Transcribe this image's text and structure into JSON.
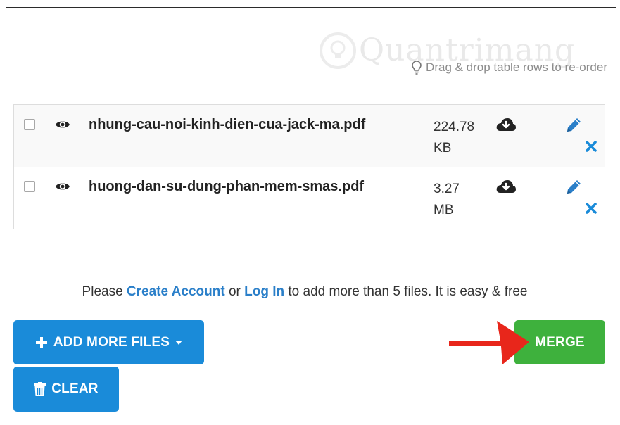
{
  "watermark": {
    "text": "Quantrimang"
  },
  "hint": {
    "text": "Drag & drop table rows to re-order",
    "icon": "lightbulb-icon"
  },
  "files": [
    {
      "name": "nhung-cau-noi-kinh-dien-cua-jack-ma.pdf",
      "size_value": "224.78",
      "size_unit": "KB"
    },
    {
      "name": "huong-dan-su-dung-phan-mem-smas.pdf",
      "size_value": "3.27",
      "size_unit": "MB"
    }
  ],
  "notice": {
    "prefix": "Please",
    "create_account": "Create Account",
    "or": "or",
    "log_in": "Log In",
    "suffix": "to add more than 5 files. It is easy & free"
  },
  "buttons": {
    "add_more": "ADD MORE FILES",
    "clear": "CLEAR",
    "merge": "MERGE"
  },
  "colors": {
    "primary": "#1a8bd9",
    "success": "#3eb13d",
    "link": "#2a7fc9",
    "annotation_arrow": "#e8261b"
  }
}
